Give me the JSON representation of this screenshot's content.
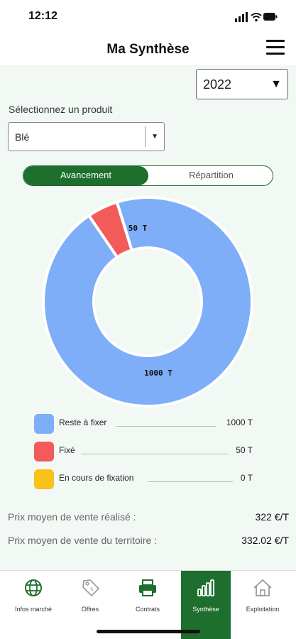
{
  "status": {
    "time": "12:12"
  },
  "header": {
    "title": "Ma Synthèse"
  },
  "year_select": {
    "value": "2022"
  },
  "product": {
    "label": "Sélectionnez un produit",
    "value": "Blé"
  },
  "segmented": {
    "active": "Avancement",
    "inactive": "Répartition"
  },
  "chart_data": {
    "type": "pie",
    "donut": true,
    "slices": [
      {
        "name": "Reste à fixer",
        "value": 1000,
        "label": "1000 T",
        "color": "#7eaef7"
      },
      {
        "name": "Fixé",
        "value": 50,
        "label": "50 T",
        "color": "#f35a5a"
      },
      {
        "name": "En cours de fixation",
        "value": 0,
        "label": "0 T",
        "color": "#f9c21b"
      }
    ]
  },
  "legend": [
    {
      "label": "Reste à fixer",
      "value": "1000 T",
      "color": "#7eaef7"
    },
    {
      "label": "Fixé",
      "value": "50 T",
      "color": "#f35a5a"
    },
    {
      "label": "En cours de fixation",
      "value": "0 T",
      "color": "#f9c21b"
    }
  ],
  "stats": [
    {
      "label": "Prix moyen de vente réalisé :",
      "value": "322 €/T"
    },
    {
      "label": "Prix moyen de vente du territoire :",
      "value": "332.02 €/T"
    }
  ],
  "tabs": [
    {
      "label": "Infos marché",
      "icon": "globe-icon"
    },
    {
      "label": "Offres",
      "icon": "tag-icon"
    },
    {
      "label": "Contrats",
      "icon": "printer-icon"
    },
    {
      "label": "Synthèse",
      "icon": "bar-chart-icon",
      "active": true
    },
    {
      "label": "Exploitation",
      "icon": "house-icon"
    }
  ],
  "colors": {
    "accent": "#1e6e2d",
    "background": "#f2f8f4"
  }
}
